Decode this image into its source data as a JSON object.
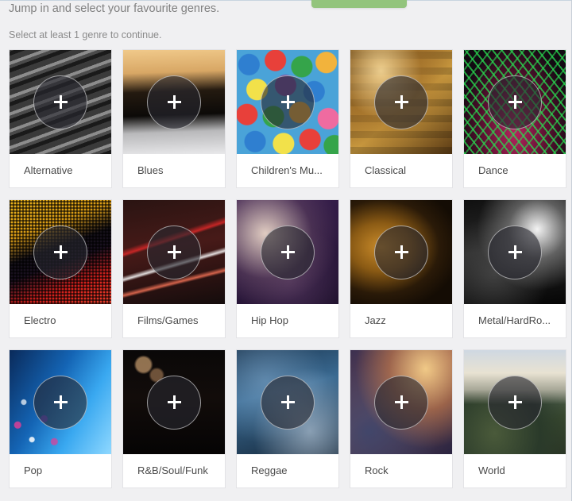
{
  "header": {
    "headline": "Jump in and select your favourite genres.",
    "subline": "Select at least 1 genre to continue.",
    "continue_label": "",
    "accent_green": "#93c47d",
    "text_color": "#808080"
  },
  "grid": {
    "columns": 5,
    "add_icon": "plus-icon",
    "cards": [
      {
        "label": "Alternative",
        "art": "art-alternative",
        "art_description": "close-up of dark grey piano keys"
      },
      {
        "label": "Blues",
        "art": "art-blues",
        "art_description": "warm golden piano keyboard at sunset"
      },
      {
        "label": "Children's Mu...",
        "art": "art-childrens",
        "art_description": "colourful plastic ball pit"
      },
      {
        "label": "Classical",
        "art": "art-classical",
        "art_description": "gilded opera house balconies"
      },
      {
        "label": "Dance",
        "art": "art-dance",
        "art_description": "green laser show over a magenta crowd"
      },
      {
        "label": "Electro",
        "art": "art-electro",
        "art_description": "yellow and red LED dot matrix panel"
      },
      {
        "label": "Films/Games",
        "art": "art-films",
        "art_description": "red and white light trails at night"
      },
      {
        "label": "Hip Hop",
        "art": "art-hiphop",
        "art_description": "purple-lit turntable and records"
      },
      {
        "label": "Jazz",
        "art": "art-jazz",
        "art_description": "golden saxophone bell close-up"
      },
      {
        "label": "Metal/HardRo...",
        "art": "art-metal",
        "art_description": "black and white concert crowd"
      },
      {
        "label": "Pop",
        "art": "art-pop",
        "art_description": "blue stage light with pink confetti"
      },
      {
        "label": "R&B/Soul/Funk",
        "art": "art-rnb",
        "art_description": "gold studio condenser microphone"
      },
      {
        "label": "Reggae",
        "art": "art-reggae",
        "art_description": "blue smoke haze"
      },
      {
        "label": "Rock",
        "art": "art-rock",
        "art_description": "guitar and denim in warm sunlight"
      },
      {
        "label": "World",
        "art": "art-world",
        "art_description": "mountain ridge landscape at dawn"
      }
    ]
  }
}
